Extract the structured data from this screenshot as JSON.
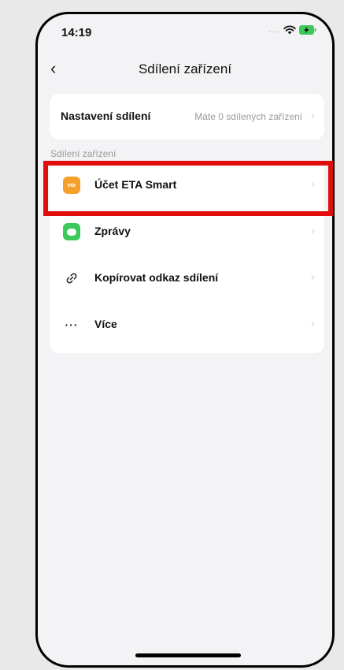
{
  "status_bar": {
    "time": "14:19",
    "signal": "....",
    "wifi_icon": "wifi-icon",
    "battery_icon": "battery-charging-icon"
  },
  "nav": {
    "back_icon": "chevron-left-icon",
    "back_glyph": "‹",
    "title": "Sdílení zařízení"
  },
  "settings": {
    "label": "Nastavení sdílení",
    "value": "Máte 0 sdílených zařízení",
    "chevron": "›"
  },
  "section": {
    "label": "Sdílení zařízení"
  },
  "share_options": [
    {
      "label": "Účet ETA Smart",
      "icon": "eta-app-icon",
      "icon_text": "eta",
      "chevron": "›"
    },
    {
      "label": "Zprávy",
      "icon": "messages-icon",
      "chevron": "›"
    },
    {
      "label": "Kopírovat odkaz sdílení",
      "icon": "link-icon",
      "icon_text": "🔗",
      "chevron": "›"
    },
    {
      "label": "Více",
      "icon": "more-icon",
      "icon_text": "···",
      "chevron": "›"
    }
  ],
  "colors": {
    "highlight": "#e10c0c",
    "eta_orange": "#f4a02a",
    "messages_green": "#3dc85a"
  }
}
